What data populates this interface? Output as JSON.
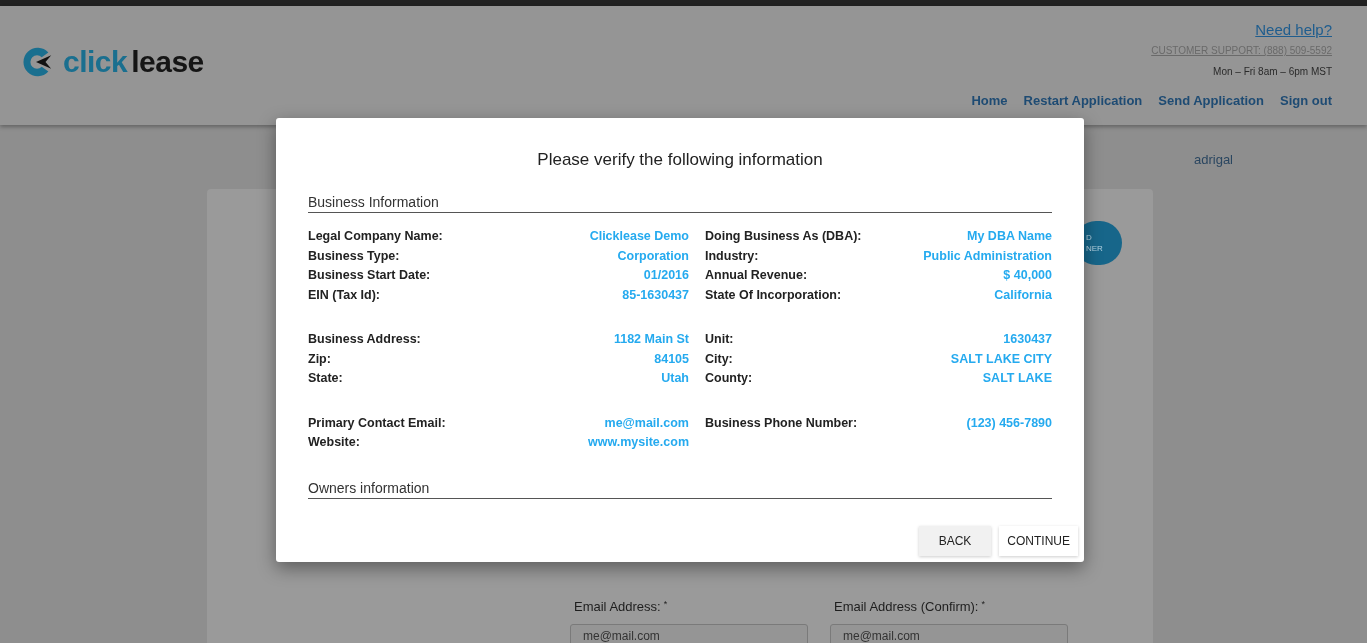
{
  "header": {
    "logo": {
      "part1": "click",
      "part2": "lease"
    },
    "help_link": "Need help?",
    "support": "CUSTOMER SUPPORT: (888) 509-5592",
    "hours": "Mon – Fri 8am – 6pm MST",
    "nav": [
      "Home",
      "Restart Application",
      "Send Application",
      "Sign out"
    ]
  },
  "background": {
    "greeting": "adrigal",
    "owner_button": {
      "line1": "D",
      "line2": "NER"
    },
    "fields": [
      {
        "label": "Email Address:",
        "required_mark": "*",
        "value": "me@mail.com"
      },
      {
        "label": "Email Address (Confirm):",
        "required_mark": "*",
        "value": "me@mail.com"
      }
    ]
  },
  "dialog": {
    "title": "Please verify the following information",
    "sections": [
      {
        "heading": "Business Information",
        "groups": [
          [
            {
              "left": {
                "label": "Legal Company Name:",
                "value": "Clicklease Demo"
              },
              "right": {
                "label": "Doing Business As (DBA):",
                "value": "My DBA Name"
              }
            },
            {
              "left": {
                "label": "Business Type:",
                "value": "Corporation"
              },
              "right": {
                "label": "Industry:",
                "value": "Public Administration"
              }
            },
            {
              "left": {
                "label": "Business Start Date:",
                "value": "01/2016"
              },
              "right": {
                "label": "Annual Revenue:",
                "value": "$ 40,000"
              }
            },
            {
              "left": {
                "label": "EIN (Tax Id):",
                "value": "85-1630437"
              },
              "right": {
                "label": "State Of Incorporation:",
                "value": "California"
              }
            }
          ],
          [
            {
              "left": {
                "label": "Business Address:",
                "value": "1182 Main St"
              },
              "right": {
                "label": "Unit:",
                "value": "1630437"
              }
            },
            {
              "left": {
                "label": "Zip:",
                "value": "84105"
              },
              "right": {
                "label": "City:",
                "value": "SALT LAKE CITY"
              }
            },
            {
              "left": {
                "label": "State:",
                "value": "Utah"
              },
              "right": {
                "label": "County:",
                "value": "SALT LAKE"
              }
            }
          ],
          [
            {
              "left": {
                "label": "Primary Contact Email:",
                "value": "me@mail.com"
              },
              "right": {
                "label": "Business Phone Number:",
                "value": "(123) 456-7890"
              }
            },
            {
              "left": {
                "label": "Website:",
                "value": "www.mysite.com"
              }
            }
          ]
        ]
      },
      {
        "heading": "Owners information"
      }
    ],
    "buttons": [
      "BACK",
      "CONTINUE"
    ]
  }
}
